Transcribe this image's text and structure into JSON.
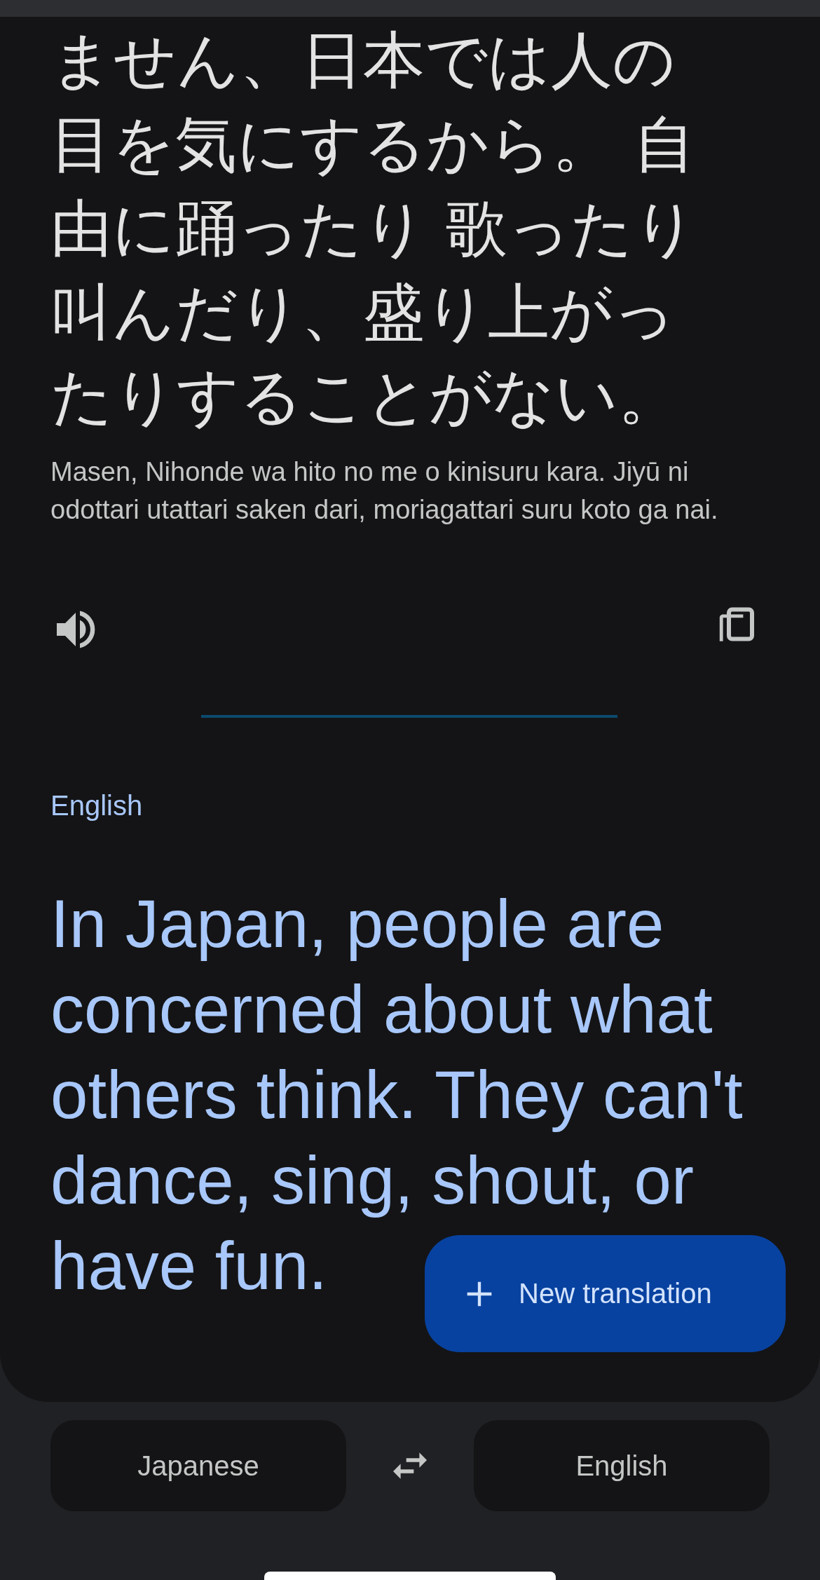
{
  "source": {
    "lines": [
      "ません、日本では人の",
      "目を気にするから。 自",
      "由に踊ったり 歌ったり",
      "叫んだり、盛り上がっ",
      "たりすることがない。"
    ],
    "transliteration": "Masen, Nihonde wa hito no me o kinisuru kara. Jiyū ni odottari utattari saken dari, moriagattari suru koto ga nai."
  },
  "target": {
    "language": "English",
    "lines": [
      "In Japan, people are",
      "concerned about what",
      "others think. They can't",
      "dance, sing, shout, or",
      "have fun."
    ]
  },
  "fab": {
    "label": "New translation"
  },
  "languages": {
    "source": "Japanese",
    "target": "English"
  }
}
